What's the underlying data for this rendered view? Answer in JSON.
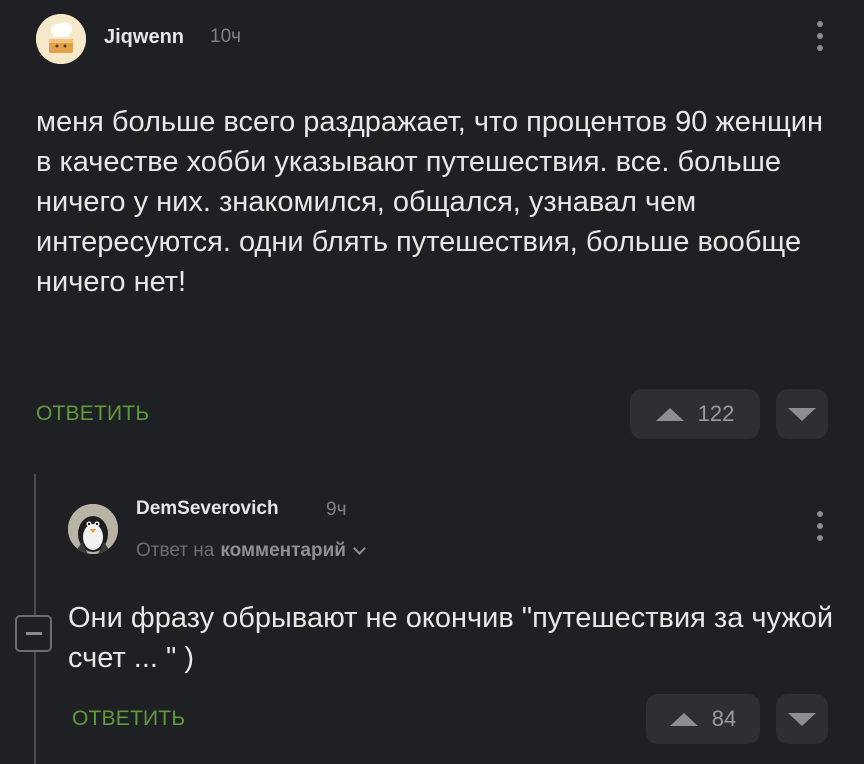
{
  "comments": [
    {
      "username": "Jiqwenn",
      "time": "10ч",
      "text": "меня больше всего раздражает, что процентов 90 женщин в качестве хобби указывают путешествия. все. больше ничего у них. знакомился, общался, узнавал чем интересуются. одни блять путешествия, больше вообще ничего нет!",
      "reply_label": "ОТВЕТИТЬ",
      "rating": "122"
    },
    {
      "username": "DemSeverovich",
      "time": "9ч",
      "reply_to_prefix": "Ответ на",
      "reply_to_link": "комментарий",
      "text": "Они фразу обрывают не окончив \"путешествия за чужой счет ... \" )",
      "reply_label": "ОТВЕТИТЬ",
      "rating": "84"
    }
  ],
  "icons": {
    "menu": "kebab-icon",
    "upvote": "triangle-up-icon",
    "downvote": "triangle-down-icon",
    "collapse": "minus-box-icon",
    "expand_reply": "chevron-down-icon"
  },
  "colors": {
    "background": "#1f2023",
    "reply_accent": "#5c9c3a",
    "vote_button_bg": "#2d2f33"
  }
}
